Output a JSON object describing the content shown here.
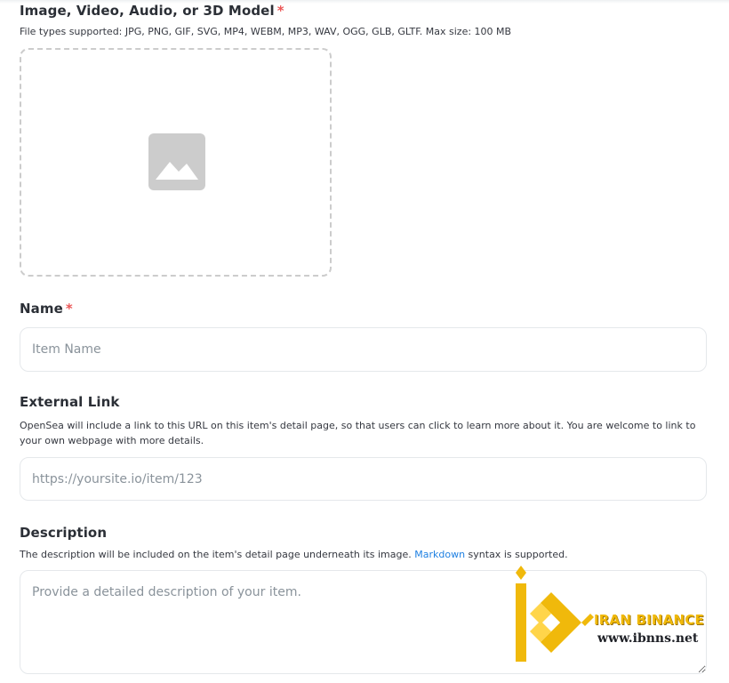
{
  "media": {
    "label": "Image, Video, Audio, or 3D Model",
    "required_mark": "*",
    "hint": "File types supported: JPG, PNG, GIF, SVG, MP4, WEBM, MP3, WAV, OGG, GLB, GLTF. Max size: 100 MB",
    "icon": "image-icon"
  },
  "name": {
    "label": "Name",
    "required_mark": "*",
    "placeholder": "Item Name"
  },
  "external_link": {
    "label": "External Link",
    "hint": "OpenSea will include a link to this URL on this item's detail page, so that users can click to learn more about it. You are welcome to link to your own webpage with more details.",
    "placeholder": "https://yoursite.io/item/123"
  },
  "description": {
    "label": "Description",
    "hint_before": "The description will be included on the item's detail page underneath its image. ",
    "hint_link": "Markdown",
    "hint_after": " syntax is supported.",
    "placeholder": "Provide a detailed description of your item."
  },
  "watermark": {
    "brand": "IRAN BINANCE",
    "site": "www.ibnns.net"
  },
  "colors": {
    "required": "#eb5757",
    "link": "#2081e2",
    "border": "#e5e8eb",
    "placeholder": "#8a939b",
    "watermark_gold": "#f0b90b"
  }
}
